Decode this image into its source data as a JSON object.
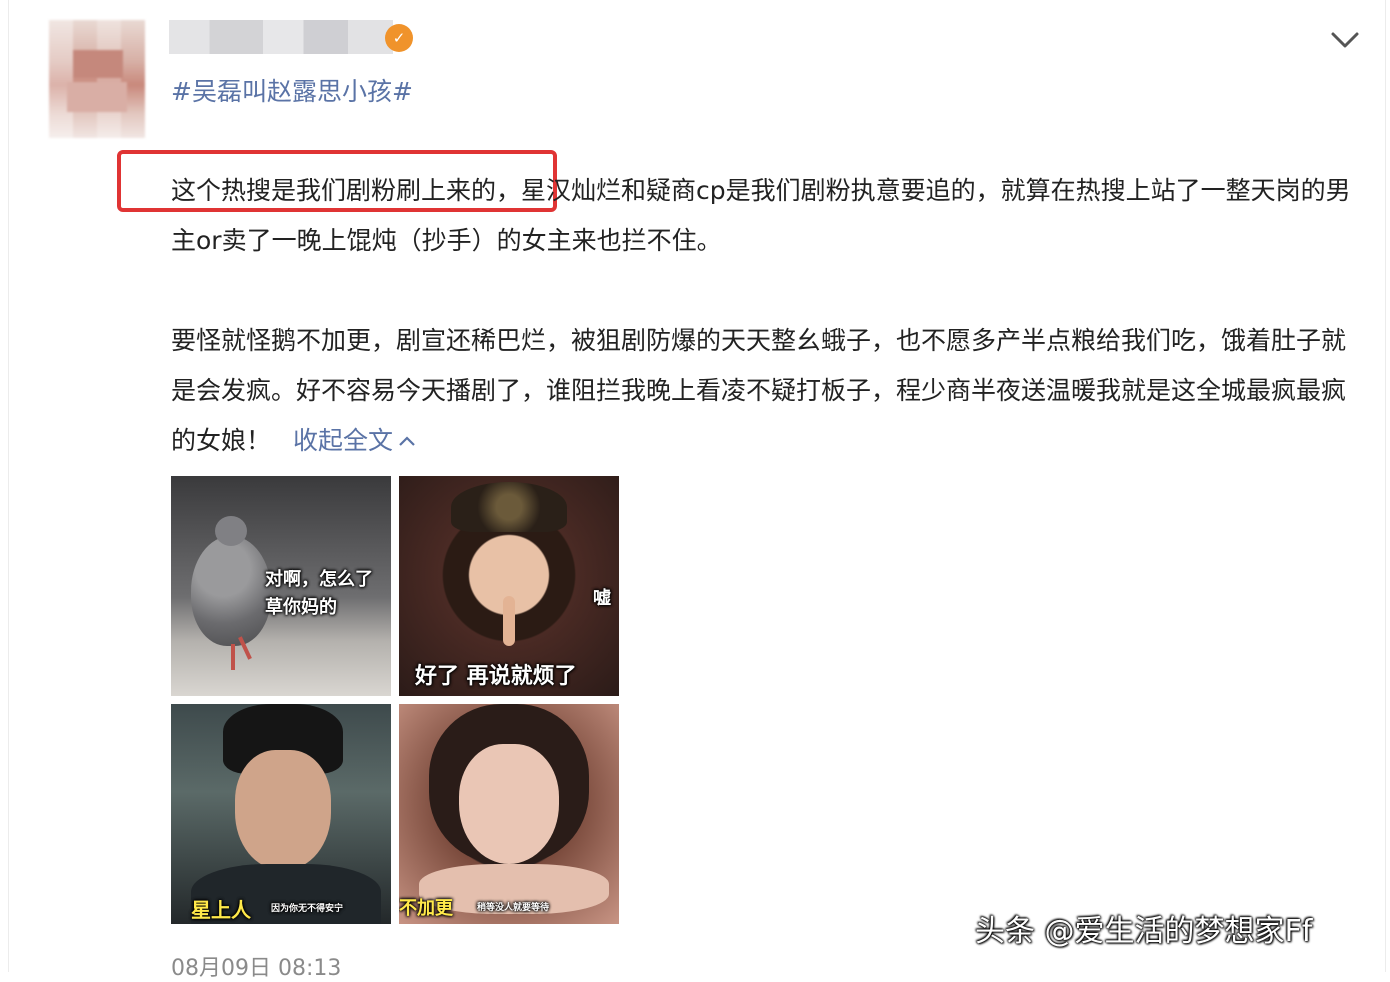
{
  "post": {
    "hashtag": "#吴磊叫赵露思小孩#",
    "text_highlighted": "这个热搜是我们剧粉刷上来的，",
    "text_p1_rest": "星汉灿烂和疑商cp是我们剧粉执意要追的，就算在热搜上站了一整天岗的男主or卖了一晚上馄炖（抄手）的女主来也拦不住。",
    "text_p2": "要怪就怪鹅不加更，剧宣还稀巴烂，被狙剧防爆的天天整幺蛾子，也不愿多产半点粮给我们吃，饿着肚子就是会发疯。好不容易今天播剧了，谁阻拦我晚上看凌不疑打板子，程少商半夜送温暖我就是这全城最疯最疯的女娘！",
    "collapse_label": "收起全文",
    "collapse_icon": "chevron-up-icon",
    "timestamp": "08月09日 08:13"
  },
  "header": {
    "menu_icon": "chevron-down-icon",
    "badge_icon": "verified-badge-icon"
  },
  "images": [
    {
      "caption": "对啊，怎么了",
      "caption2": "草你妈的"
    },
    {
      "caption": "嘘",
      "caption2": "好了 再说就烦了"
    },
    {
      "caption": "星上人",
      "caption2": "因为你无不得安宁"
    },
    {
      "caption": "不加更",
      "caption2": "稍等没人就要等待"
    }
  ],
  "watermark": "头条 @爱生活的梦想家Ff",
  "colors": {
    "link": "#5a73a6",
    "highlight_box": "#e03434"
  }
}
